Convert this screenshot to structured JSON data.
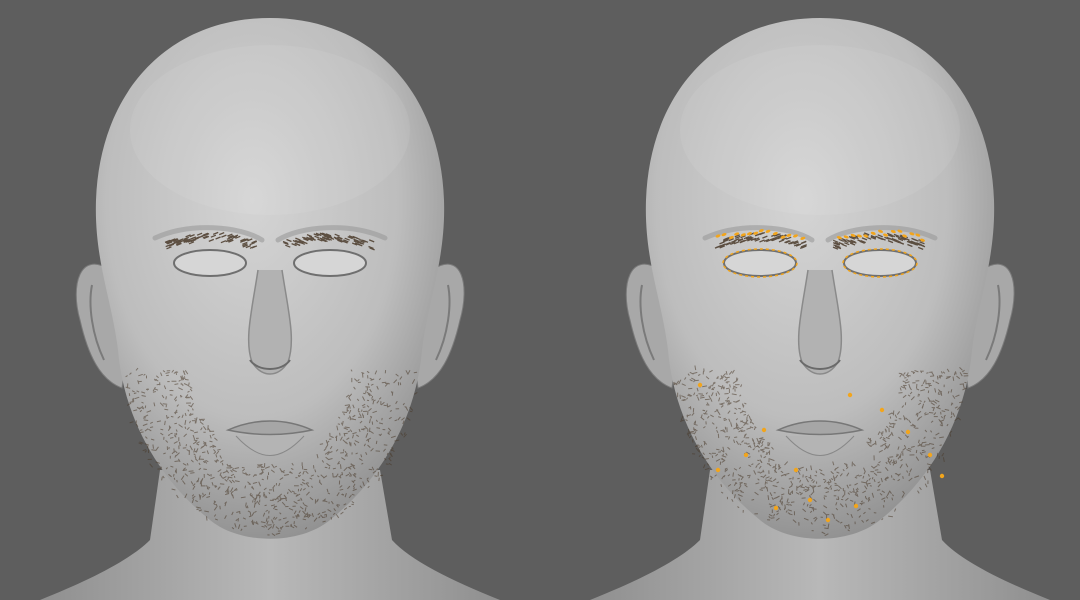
{
  "scene": {
    "background_color": "#5e5e5e",
    "skin_color": "#bdbdbd",
    "hair_color": "#4a3a2a",
    "highlight_color": "#f2a51c"
  },
  "renders": [
    {
      "name": "groom-render",
      "marker_overlay": false
    },
    {
      "name": "groom-guides-render",
      "marker_overlay": true
    }
  ]
}
